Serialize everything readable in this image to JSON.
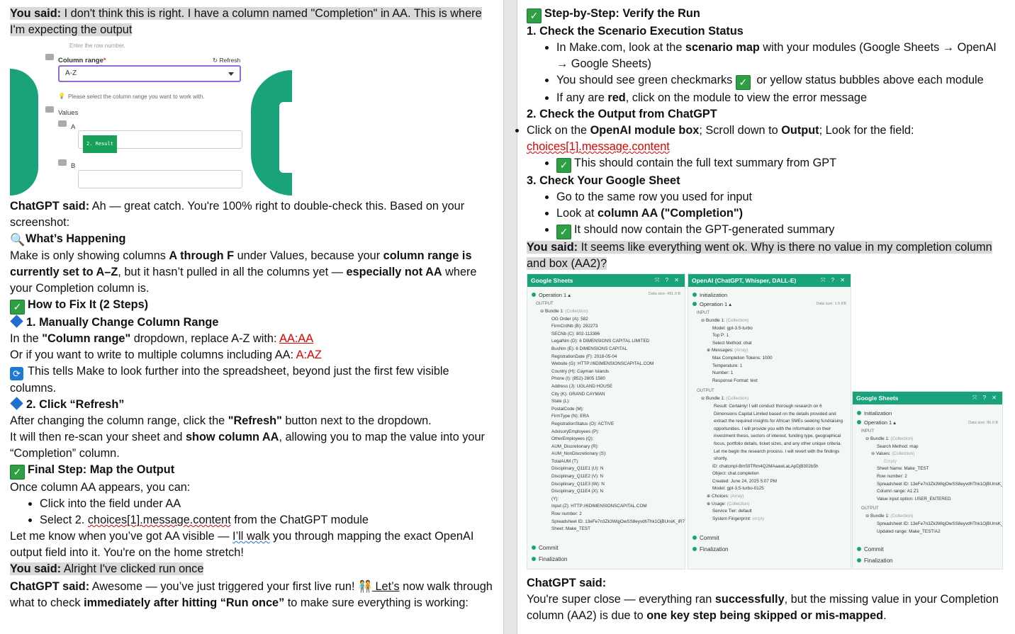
{
  "left": {
    "p1_label": "You said:",
    "p1_text": " I don't think this is right. I have a column named \"Completion\" in AA. This is where I'm expecting the output",
    "shot1": {
      "row_hint": "Enter the row number.",
      "column_range_label": "Column range",
      "required_mark": "*",
      "refresh": "Refresh",
      "select_value": "A-Z",
      "help": "Please select the column range you want to work with.",
      "values_label": "Values",
      "a_label": "A",
      "pill": "2. Result",
      "b_label": "B"
    },
    "p2_label": "ChatGPT said:",
    "p2_text": " Ah — great catch. You're 100% right to double-check this. Based on your screenshot:",
    "h_happening": "What’s Happening",
    "p3_a": "Make is only showing columns ",
    "p3_b": "A through F",
    "p3_c": " under Values, because your ",
    "p3_d": "column range is currently set to A–Z",
    "p3_e": ", but it hasn’t pulled in all the columns yet — ",
    "p3_f": "especially not AA",
    "p3_g": " where your Completion column is.",
    "h_fix": "How to Fix It (2 Steps)",
    "h_step1": "1. Manually Change Column Range",
    "p4_a": "In the ",
    "p4_b": "\"Column range\"",
    "p4_c": " dropdown, replace A-Z with: ",
    "p4_d": "AA:AA",
    "p5_a": "Or if you want to write to multiple columns including AA: ",
    "p5_b": "A:AZ",
    "p6": "This tells Make to look further into the spreadsheet, beyond just the first few visible columns.",
    "h_step2": "2. Click “Refresh”",
    "p7_a": "After changing the column range, click the ",
    "p7_b": "\"Refresh\"",
    "p7_c": " button next to the dropdown.",
    "p8_a": "It will then re-scan your sheet and ",
    "p8_b": "show column AA",
    "p8_c": ", allowing you to map the value into your “Completion” column.",
    "h_final": "Final Step: Map the Output",
    "p9": "Once column AA appears, you can:",
    "li1": "Click into the field under AA",
    "li2_a": "Select 2. ",
    "li2_b": "choices[1].message.content",
    "li2_c": " from the ChatGPT module",
    "p10_a": "Let me know when you’ve got AA visible — ",
    "p10_b": "I’ll walk",
    "p10_c": " you through mapping the exact OpenAI output field into it. You're on the home stretch!",
    "p11_label": "You said:",
    "p11_text": " Alright I've clicked run once",
    "p12_label": "ChatGPT said:",
    "p12_a": " Awesome — you’ve just triggered your first live run! ",
    "p12_b": " Let’s",
    "p12_c": " now walk through what to check ",
    "p12_d": "immediately after hitting “Run once”",
    "p12_e": " to make sure everything is working:"
  },
  "right": {
    "h_verify": "Step-by-Step: Verify the Run",
    "h1": "1. Check the Scenario Execution Status",
    "b1_a": "In Make.com, look at the ",
    "b1_b": "scenario map",
    "b1_c": " with your modules (Google Sheets → OpenAI → Google Sheets)",
    "b2_a": "You should see green checkmarks ",
    "b2_b": " or yellow status bubbles above each module",
    "b3_a": "If any are ",
    "b3_b": "red",
    "b3_c": ", click on the module to view the error message",
    "h2": "2. Check the Output from ChatGPT",
    "b4_a": "Click on the ",
    "b4_b": "OpenAI module box",
    "b4_c": "; Scroll down to ",
    "b4_d": "Output",
    "b4_e": "; Look for the field: ",
    "b4_f": "choices[1].message.content",
    "b5": "This should contain the full text summary from GPT",
    "h3": "3. Check Your Google Sheet",
    "b6": "Go to the same row you used for input",
    "b7_a": "Look at ",
    "b7_b": "column AA (\"Completion\")",
    "b8": "It should now contain the GPT-generated summary",
    "p_ask_label": "You said:",
    "p_ask_text": " It seems like everything went ok. Why is there no value in my completion column and box (AA2)?",
    "shot2": {
      "gs1": {
        "title": "Google Sheets",
        "controls": "⤧ ? ✕",
        "op": "Operation 1 ▴",
        "data_size": "Data size: 491.0 B",
        "output": "OUTPUT",
        "bundle": "Bundle 1:",
        "bundle_type": "(Collection)",
        "rows": [
          "OG Order (A): 582",
          "FirmCrdNb (B): 292273",
          "SECNb (C): 802-113386",
          "LegalNm (D): 6 DIMENSIONS CAPITAL LIMITED",
          "BusNm (E): 6 DIMENSIONS CAPITAL",
          "RegistrationDate (F): 2018-05-04",
          "Website (G): HTTP://6DIMENSIONSCAPITAL.COM",
          "Country (H): Cayman Islands",
          "Phone (I): (852)-2805 1580",
          "Address (J): UGLAND HOUSE",
          "City (K): GRAND CAYMAN",
          "State (L):",
          "PostalCode (M):",
          "FirmType (N): ERA",
          "RegistrationStatus (O): ACTIVE",
          "AdvisoryEmployees (P):",
          "OtherEmployees (Q):",
          "AUM_Discretionary (R):",
          "AUM_NonDiscretionary (S):",
          "TotalAUM (T):",
          "Disciplinary_Q11E1 (U): N",
          "Disciplinary_Q11E2 (V): N",
          "Disciplinary_Q11E3 (W): N",
          "Disciplinary_Q11E4 (X): N",
          "(Y):",
          "Input (Z): HTTP://6DIMENSIONSCAPITAL.COM",
          "Row number: 2",
          "Spreadsheet ID: 13eFe7n3Zk3WqjOwSS8eyvdhThk1OjBUnsK_iR7iwn",
          "Sheet: Make_TEST"
        ],
        "commit": "Commit",
        "finalization": "Finalization"
      },
      "oa": {
        "title": "OpenAI (ChatGPT, Whisper, DALL-E)",
        "controls": "⤧ ? ✕",
        "init": "Initialization",
        "op": "Operation 1 ▴",
        "data_size": "Data size: 1.5 KB",
        "input": "INPUT",
        "bundle": "Bundle 1:",
        "bundle_type": "(Collection)",
        "in_rows": [
          "Model: gpt-3.5-turbo",
          "Top P: 1",
          "Select Method: chat"
        ],
        "messages": "Messages:",
        "messages_type": "(Array)",
        "in_rows2": [
          "Max Completion Tokens: 1000",
          "Temperature: 1",
          "Number: 1",
          "Response Format: text"
        ],
        "output": "OUTPUT",
        "bundle2": "Bundle 1:",
        "bundle2_type": "(Collection)",
        "result": "Result: Certainly! I will conduct thorough research on 6 Dimensions Capital Limited based on the details provided and extract the required insights for African SMEs seeking fundraising opportunities. I will provide you with the information on their investment thesis, sectors of interest, funding type, geographical focus, portfolio details, ticket sizes, and any other unique criteria. Let me begin the research process. I will revert with the findings shortly.",
        "out_rows": [
          "ID: chatcmpl-Bm59TRm4Q2MAaawLaLApDjB302b5h",
          "Object: chat.completion",
          "Created: June 24, 2025 5:07 PM",
          "Model: gpt-3.5-turbo-0125"
        ],
        "choices": "Choices:",
        "choices_type": "(Array)",
        "usage": "Usage:",
        "usage_type": "(Collection)",
        "out_rows2": [
          "Service Tier: default",
          "System Fingerprint:"
        ],
        "fp_type": "empty",
        "commit": "Commit",
        "finalization": "Finalization"
      },
      "gs2": {
        "title": "Google Sheets",
        "controls": "⤧ ? ✕",
        "init": "Initialization",
        "op": "Operation 1 ▴",
        "data_size": "Data size: 96.0 B",
        "input": "INPUT",
        "bundle": "Bundle 1:",
        "bundle_type": "(Collection)",
        "search": "Search Method: map",
        "values": "Values:",
        "values_type": "(Collection)",
        "empty": "Empty",
        "in_rows": [
          "Sheet Name: Make_TEST",
          "Row number: 2",
          "Spreadsheet ID: 13eFe7n3Zk3WqjOwSS8eyvdhThk1OjBUnsK_iR7iwn",
          "Column range: A1:Z1",
          "Value input option: USER_ENTERED"
        ],
        "output": "OUTPUT",
        "bundle2": "Bundle 1:",
        "bundle2_type": "(Collection)",
        "out_rows": [
          "Spreadsheet ID: 13eFe7n3Zk3WqjOwSS8eyvdhThk1OjBUnsK_iR7iwn",
          "Updated range: Make_TEST!A2"
        ],
        "commit": "Commit",
        "finalization": "Finalization"
      }
    },
    "p_ans_label": "ChatGPT said:",
    "p_ans_a": "You're super close — everything ran ",
    "p_ans_b": "successfully",
    "p_ans_c": ", but the missing value in your Completion column (AA2) is due to ",
    "p_ans_d": "one key step being skipped or mis-mapped",
    "p_ans_e": "."
  },
  "colors": {
    "accent_green": "#2ea043",
    "make_green": "#1aa37a",
    "link_red": "#e00000",
    "diamond_blue": "#1f6fd1",
    "highlight_gray": "#d9d9d9"
  },
  "icons": [
    "check-icon",
    "magnifier-icon",
    "blue-diamond-icon",
    "refresh-icon",
    "people-icon"
  ]
}
